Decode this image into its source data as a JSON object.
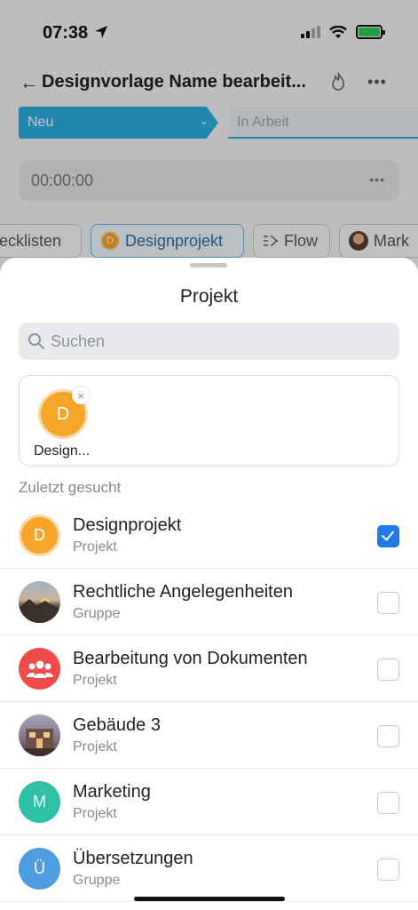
{
  "status_bar": {
    "time": "07:38"
  },
  "header": {
    "title": "Designvorlage Name bearbeit..."
  },
  "stages": {
    "current": "Neu",
    "next": "In Arbeit"
  },
  "timer": {
    "value": "00:00:00"
  },
  "chips": [
    {
      "label": "ecklisten"
    },
    {
      "label": "Designprojekt",
      "avatar_letter": "D"
    },
    {
      "label": "Flow"
    },
    {
      "label": "Mark"
    }
  ],
  "sheet": {
    "title": "Projekt",
    "search_placeholder": "Suchen",
    "selected": {
      "letter": "D",
      "label": "Design...",
      "remove": "×"
    },
    "section_label": "Zuletzt gesucht",
    "items": [
      {
        "name": "Designprojekt",
        "type": "Projekt",
        "letter": "D",
        "checked": true
      },
      {
        "name": "Rechtliche Angelegenheiten",
        "type": "Gruppe",
        "checked": false
      },
      {
        "name": "Bearbeitung von Dokumenten",
        "type": "Projekt",
        "checked": false
      },
      {
        "name": "Gebäude 3",
        "type": "Projekt",
        "checked": false
      },
      {
        "name": "Marketing",
        "type": "Projekt",
        "letter": "M",
        "checked": false
      },
      {
        "name": "Übersetzungen",
        "type": "Gruppe",
        "letter": "Ü",
        "checked": false
      }
    ]
  },
  "colors": {
    "accent": "#29aedf",
    "checkbox": "#1e7ae6",
    "orange_avatar": "#f4a52a",
    "red_avatar": "#ef4b4b",
    "teal_avatar": "#2ec1a6",
    "blue_avatar": "#4d9ddf"
  }
}
